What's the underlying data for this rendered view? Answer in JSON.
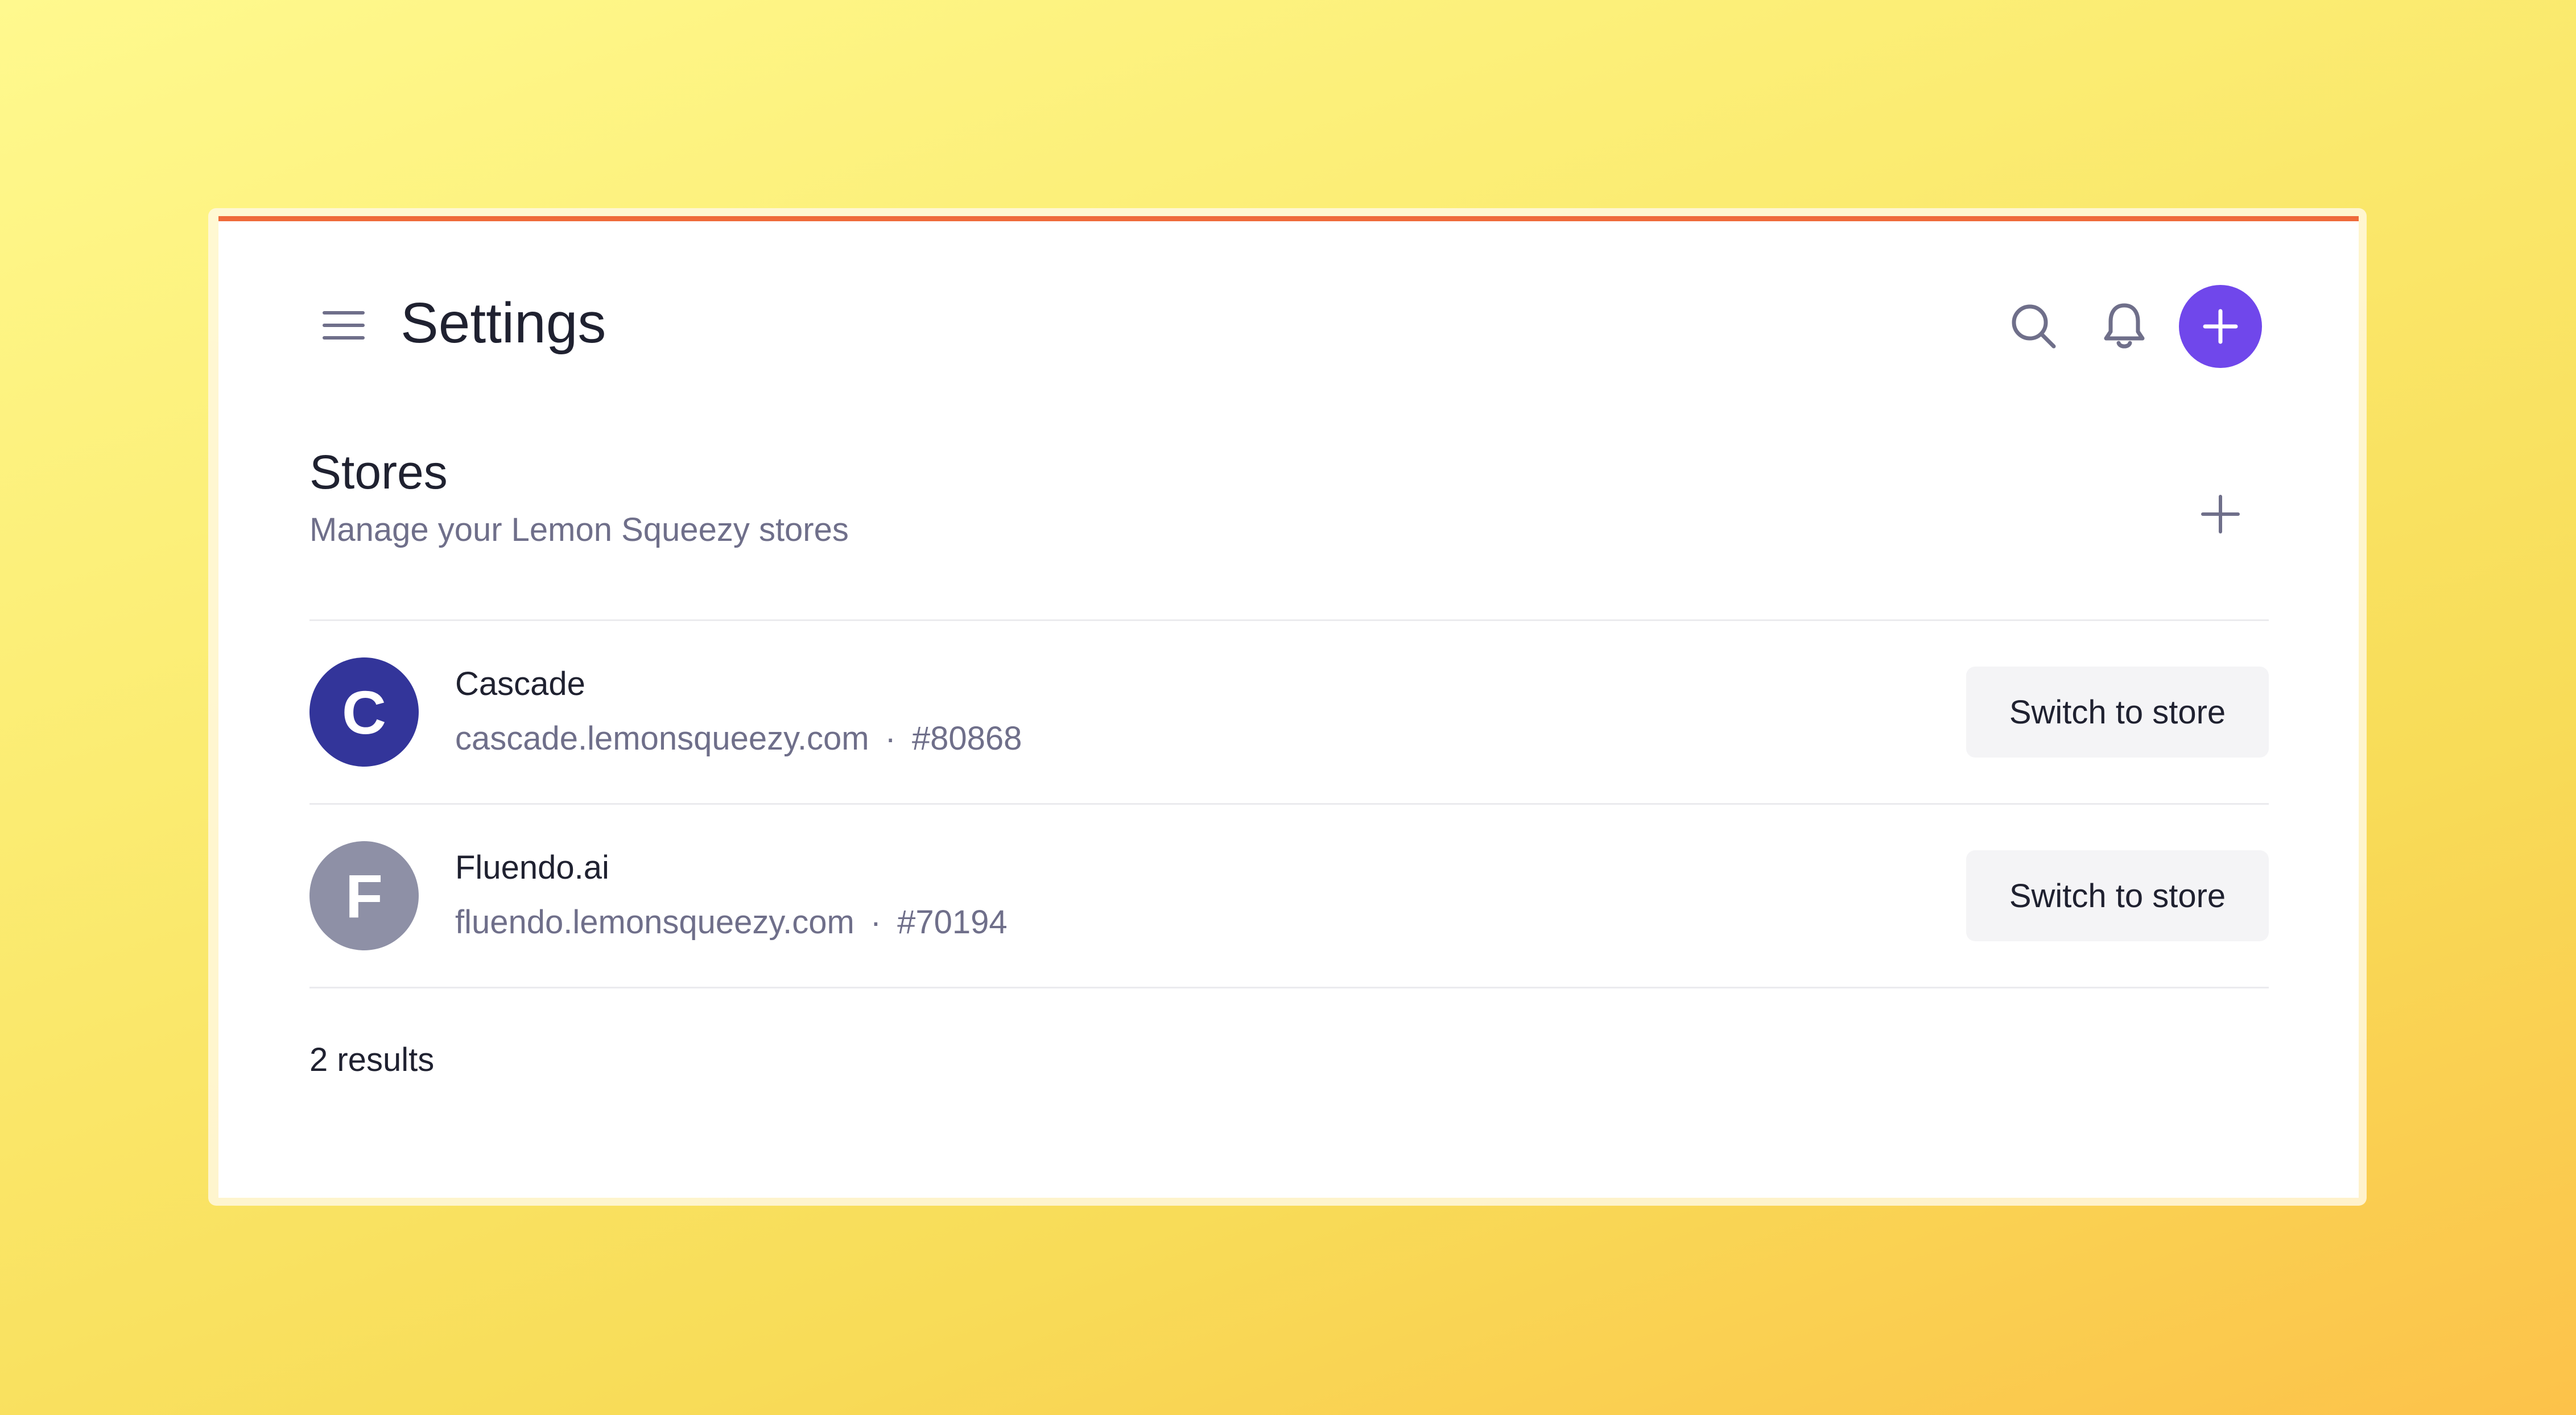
{
  "header": {
    "title": "Settings",
    "menu_icon": "hamburger-menu-icon",
    "search_icon": "search-icon",
    "notification_icon": "bell-icon",
    "add_icon": "plus-icon"
  },
  "stores_section": {
    "title": "Stores",
    "subtitle": "Manage your Lemon Squeezy stores",
    "add_icon": "plus-icon"
  },
  "stores": [
    {
      "initial": "C",
      "name": "Cascade",
      "domain": "cascade.lemonsqueezy.com",
      "separator": "·",
      "id": "#80868",
      "avatar_color": "#33359a",
      "action_label": "Switch to store"
    },
    {
      "initial": "F",
      "name": "Fluendo.ai",
      "domain": "fluendo.lemonsqueezy.com",
      "separator": "·",
      "id": "#70194",
      "avatar_color": "#8e90a6",
      "action_label": "Switch to store"
    }
  ],
  "results_count": "2 results",
  "colors": {
    "accent": "#7047eb",
    "top_border": "#ef6a3a",
    "muted_text": "#6f6f8a",
    "primary_text": "#1f2130"
  }
}
